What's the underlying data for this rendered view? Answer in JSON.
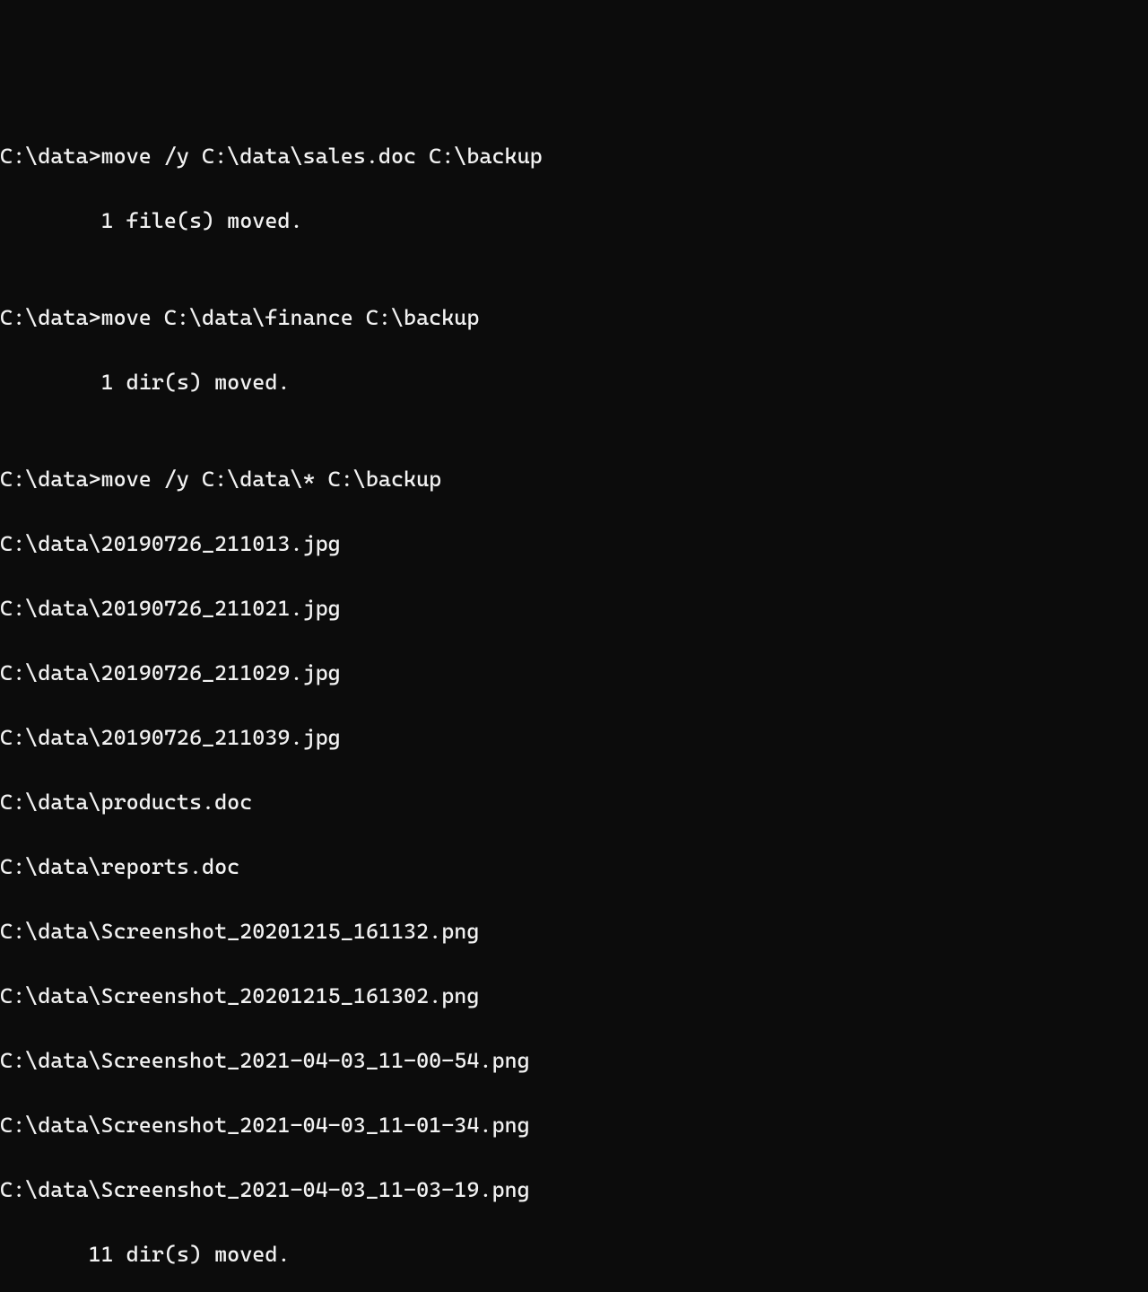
{
  "prompt": "C:\\data>",
  "blank": "",
  "sessions": [
    {
      "command": "move /y C:\\data\\sales.doc C:\\backup",
      "result": "        1 file(s) moved."
    },
    {
      "command": "move C:\\data\\finance C:\\backup",
      "result": "        1 dir(s) moved."
    },
    {
      "command": "move /y C:\\data\\* C:\\backup",
      "files": [
        "C:\\data\\20190726_211013.jpg",
        "C:\\data\\20190726_211021.jpg",
        "C:\\data\\20190726_211029.jpg",
        "C:\\data\\20190726_211039.jpg",
        "C:\\data\\products.doc",
        "C:\\data\\reports.doc",
        "C:\\data\\Screenshot_20201215_161132.png",
        "C:\\data\\Screenshot_20201215_161302.png",
        "C:\\data\\Screenshot_2021-04-03_11-00-54.png",
        "C:\\data\\Screenshot_2021-04-03_11-01-34.png",
        "C:\\data\\Screenshot_2021-04-03_11-03-19.png"
      ],
      "result": "       11 dir(s) moved."
    }
  ]
}
